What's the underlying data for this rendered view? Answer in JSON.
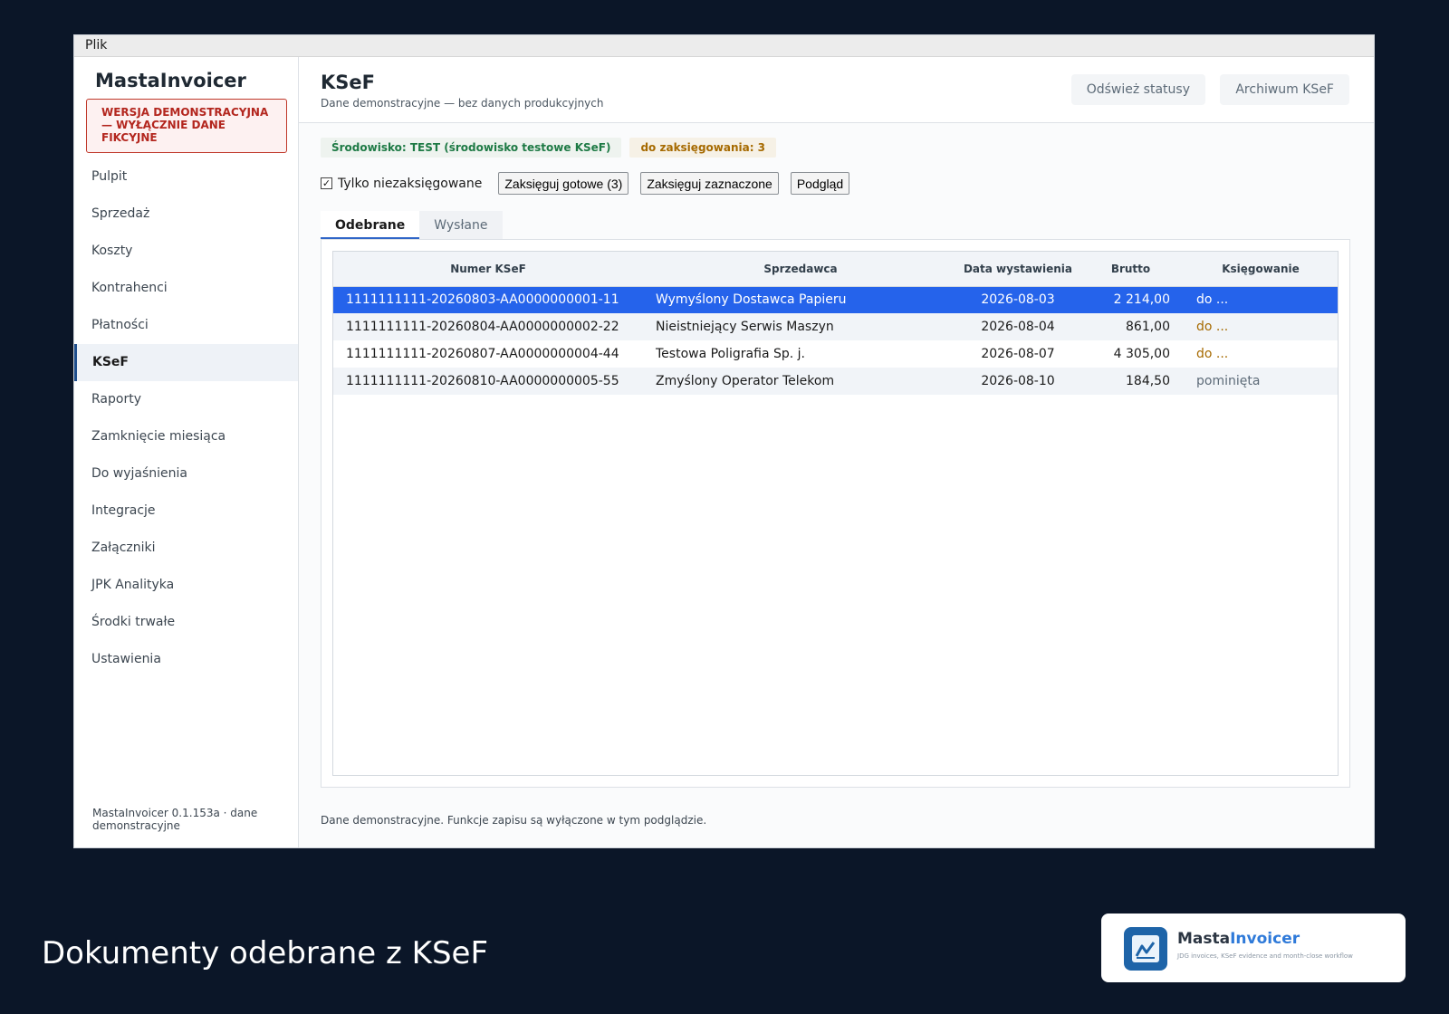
{
  "menubar": {
    "file": "Plik"
  },
  "sidebar": {
    "brand": "MastaInvoicer",
    "demo_notice": "WERSJA DEMONSTRACYJNA — WYŁĄCZNIE DANE FIKCYJNE",
    "items": [
      {
        "label": "Pulpit"
      },
      {
        "label": "Sprzedaż"
      },
      {
        "label": "Koszty"
      },
      {
        "label": "Kontrahenci"
      },
      {
        "label": "Płatności"
      },
      {
        "label": "KSeF"
      },
      {
        "label": "Raporty"
      },
      {
        "label": "Zamknięcie miesiąca"
      },
      {
        "label": "Do wyjaśnienia"
      },
      {
        "label": "Integracje"
      },
      {
        "label": "Załączniki"
      },
      {
        "label": "JPK Analityka"
      },
      {
        "label": "Środki trwałe"
      },
      {
        "label": "Ustawienia"
      }
    ],
    "footer": "MastaInvoicer 0.1.153a · dane demonstracyjne"
  },
  "header": {
    "title": "KSeF",
    "subtitle": "Dane demonstracyjne — bez danych produkcyjnych",
    "refresh_label": "Odśwież statusy",
    "archive_label": "Archiwum KSeF"
  },
  "badges": {
    "environment": "Środowisko: TEST (środowisko testowe KSeF)",
    "to_post": "do zaksięgowania: 3"
  },
  "toolbar": {
    "only_unposted_label": "Tylko niezaksięgowane",
    "only_unposted_checked": "✓",
    "post_ready_label": "Zaksięguj gotowe (3)",
    "post_selected_label": "Zaksięguj zaznaczone",
    "preview_label": "Podgląd"
  },
  "tabs": [
    {
      "label": "Odebrane"
    },
    {
      "label": "Wysłane"
    }
  ],
  "table": {
    "columns": [
      "Numer KSeF",
      "Sprzedawca",
      "Data wystawienia",
      "Brutto",
      "Księgowanie"
    ],
    "rows": [
      {
        "ksef": "1111111111-20260803-AA0000000001-11",
        "seller": "Wymyślony Dostawca Papieru",
        "date": "2026-08-03",
        "gross": "2 214,00",
        "status": "do ..."
      },
      {
        "ksef": "1111111111-20260804-AA0000000002-22",
        "seller": "Nieistniejący Serwis Maszyn",
        "date": "2026-08-04",
        "gross": "861,00",
        "status": "do ..."
      },
      {
        "ksef": "1111111111-20260807-AA0000000004-44",
        "seller": "Testowa Poligrafia Sp. j.",
        "date": "2026-08-07",
        "gross": "4 305,00",
        "status": "do ..."
      },
      {
        "ksef": "1111111111-20260810-AA0000000005-55",
        "seller": "Zmyślony Operator Telekom",
        "date": "2026-08-10",
        "gross": "184,50",
        "status": "pominięta"
      }
    ]
  },
  "footer_note": "Dane demonstracyjne. Funkcje zapisu są wyłączone w tym podglądzie.",
  "caption": "Dokumenty odebrane z KSeF",
  "logo": {
    "name_part1": "Masta",
    "name_part2": "Invoicer",
    "tagline": "JDG invoices, KSeF evidence and month-close workflow"
  },
  "colors": {
    "accent": "#2563eb",
    "pending": "#a66a00",
    "env_green": "#1e7a45",
    "demo_red": "#b3261e",
    "background": "#0b1628"
  }
}
